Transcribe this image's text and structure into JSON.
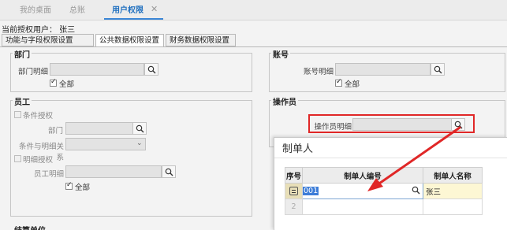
{
  "tabs": [
    "我的桌面",
    "总账",
    "用户权限"
  ],
  "tab_close": "✕",
  "current_user": "当前授权用户： 张三",
  "subtabs": [
    "功能与字段权限设置",
    "公共数据权限设置",
    "财务数据权限设置"
  ],
  "dept": {
    "title": "部门",
    "detail_label": "部门明细",
    "all_label": "全部"
  },
  "account": {
    "title": "账号",
    "detail_label": "账号明细",
    "all_label": "全部"
  },
  "employee": {
    "title": "员工",
    "cond_auth": "条件授权",
    "dept_label": "部门",
    "cond_rel_label": "条件与明细关系",
    "detail_auth": "明细授权",
    "emp_detail_label": "员工明细",
    "all_label": "全部"
  },
  "operator": {
    "title": "操作员",
    "detail_label": "操作员明细"
  },
  "bottom_title_partial": "结算单位",
  "popup": {
    "title": "制单人",
    "columns": [
      "序号",
      "制单人编号",
      "制单人名称"
    ],
    "rows": [
      {
        "num": "1",
        "code": "001",
        "name": "张三"
      },
      {
        "num": "2",
        "code": "",
        "name": ""
      }
    ]
  },
  "colors": {
    "accent": "#3b86d6",
    "highlight": "#e02727",
    "row_selected": "#fdf7d4"
  }
}
